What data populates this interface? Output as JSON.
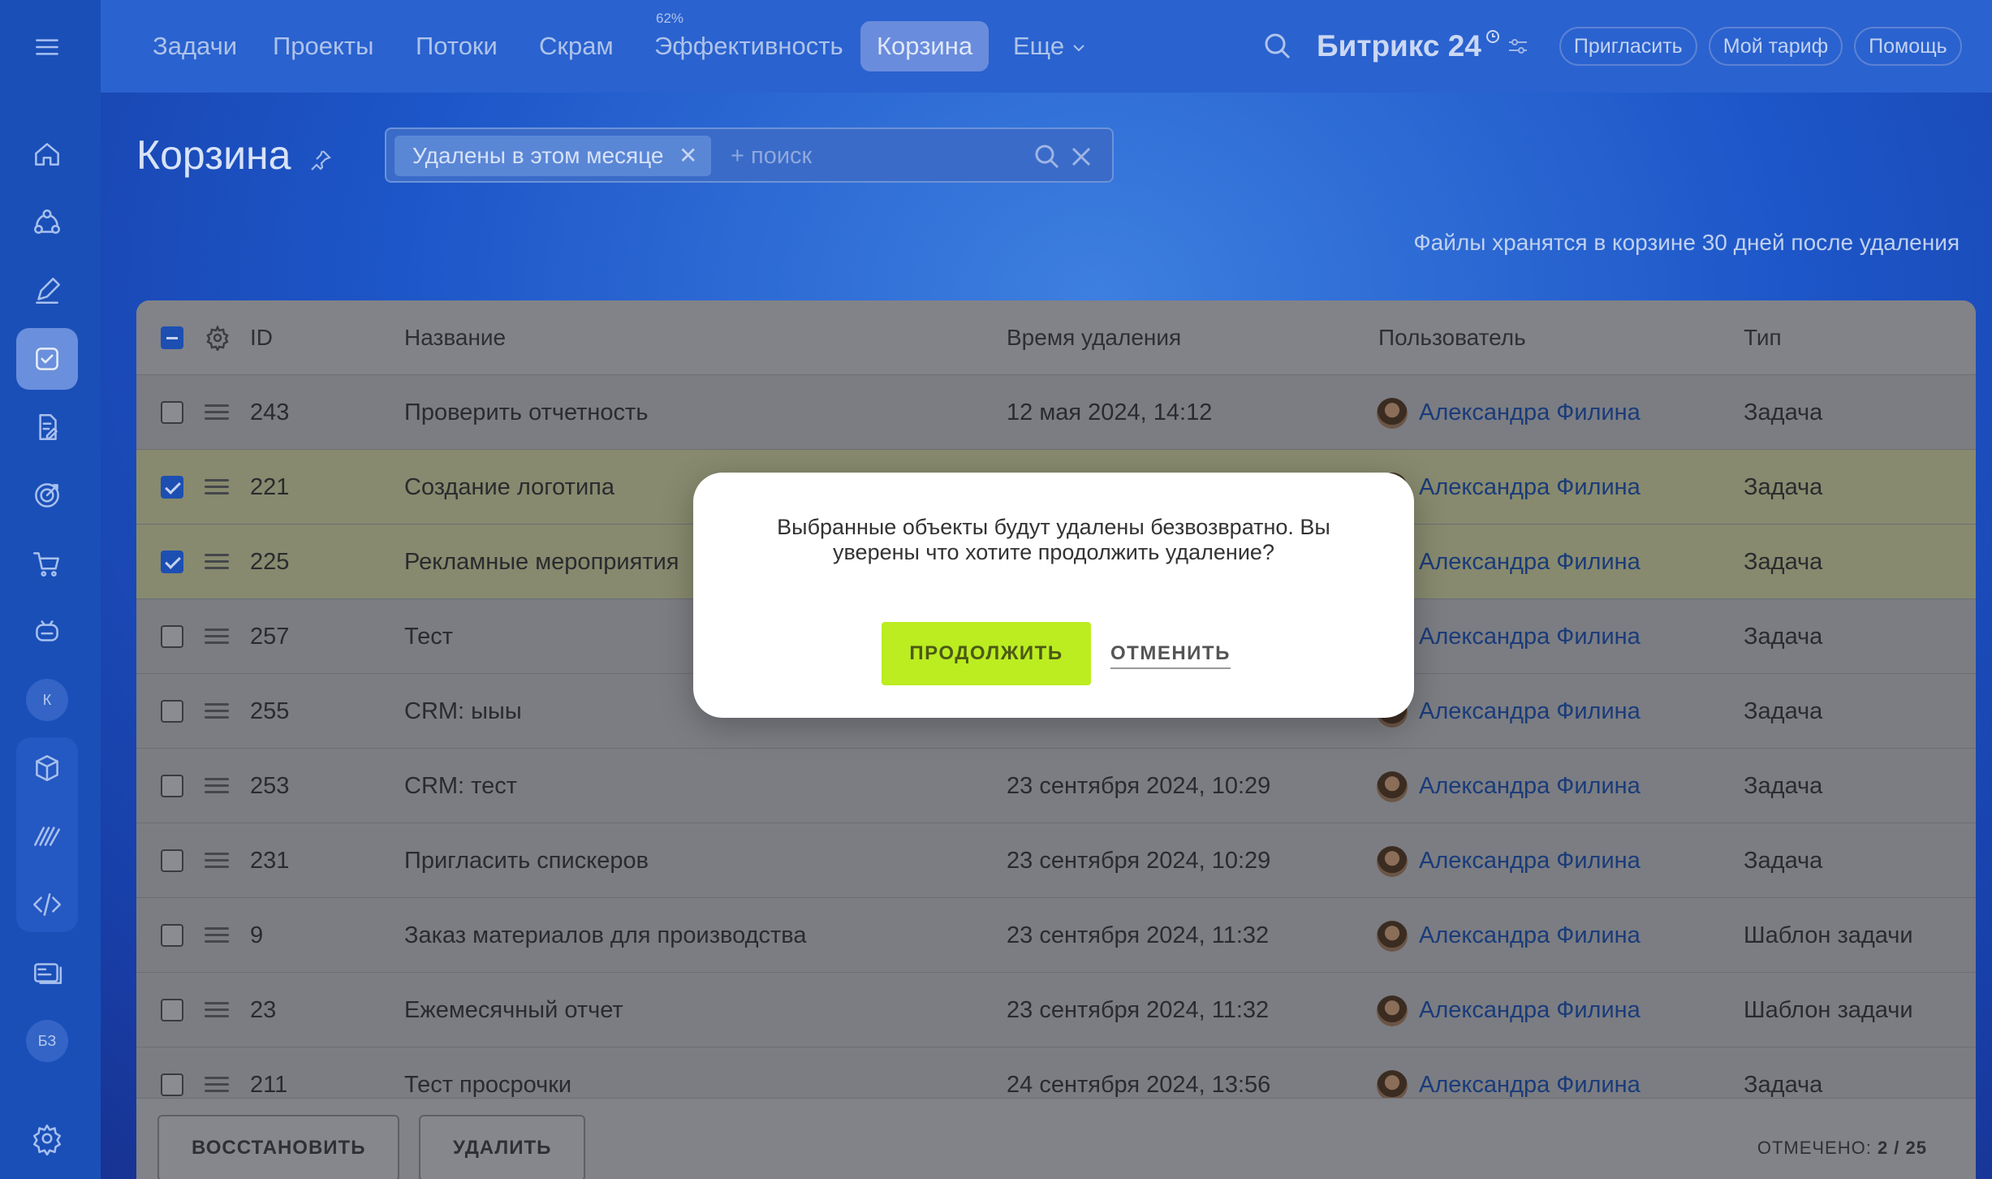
{
  "nav": {
    "items": [
      "Задачи",
      "Проекты",
      "Потоки",
      "Скрам",
      "Эффективность",
      "Корзина",
      "Еще"
    ],
    "efficiency_badge": "62%",
    "brand": "Битрикс 24",
    "invite": "Пригласить",
    "tariff": "Мой тариф",
    "help": "Помощь"
  },
  "sidebar": {
    "items": [
      "menu-icon",
      "home-icon",
      "crm-icon",
      "pen-icon",
      "tasks-icon",
      "docs-icon",
      "target-icon",
      "cart-icon",
      "robot-icon",
      "profile",
      "box-icon",
      "signature-icon",
      "code-icon",
      "cards-icon",
      "kb",
      "settings-icon"
    ],
    "profile_initial": "К",
    "kb_label": "БЗ"
  },
  "header": {
    "title": "Корзина",
    "filter_chip": "Удалены в этом месяце",
    "search_placeholder": "+ поиск",
    "storage_note": "Файлы хранятся в корзине 30 дней после удаления"
  },
  "grid": {
    "columns": [
      "ID",
      "Название",
      "Время удаления",
      "Пользователь",
      "Тип"
    ],
    "rows": [
      {
        "id": "243",
        "name": "Проверить отчетность",
        "time": "12 мая 2024, 14:12",
        "user": "Александра Филина",
        "type": "Задача",
        "checked": false
      },
      {
        "id": "221",
        "name": "Создание логотипа",
        "time": "",
        "user": "Александра Филина",
        "type": "Задача",
        "checked": true
      },
      {
        "id": "225",
        "name": "Рекламные мероприятия",
        "time": "",
        "user": "Александра Филина",
        "type": "Задача",
        "checked": true
      },
      {
        "id": "257",
        "name": "Тест",
        "time": "",
        "user": "Александра Филина",
        "type": "Задача",
        "checked": false
      },
      {
        "id": "255",
        "name": "CRM: ыыы",
        "time": "",
        "user": "Александра Филина",
        "type": "Задача",
        "checked": false
      },
      {
        "id": "253",
        "name": "CRM: тест",
        "time": "23 сентября 2024, 10:29",
        "user": "Александра Филина",
        "type": "Задача",
        "checked": false
      },
      {
        "id": "231",
        "name": "Пригласить спискеров",
        "time": "23 сентября 2024, 10:29",
        "user": "Александра Филина",
        "type": "Задача",
        "checked": false
      },
      {
        "id": "9",
        "name": "Заказ материалов для производства",
        "time": "23 сентября 2024, 11:32",
        "user": "Александра Филина",
        "type": "Шаблон задачи",
        "checked": false
      },
      {
        "id": "23",
        "name": "Ежемесячный отчет",
        "time": "23 сентября 2024, 11:32",
        "user": "Александра Филина",
        "type": "Шаблон задачи",
        "checked": false
      },
      {
        "id": "211",
        "name": "Тест просрочки",
        "time": "24 сентября 2024, 13:56",
        "user": "Александра Филина",
        "type": "Задача",
        "checked": false
      }
    ]
  },
  "footer": {
    "restore": "ВОССТАНОВИТЬ",
    "delete": "УДАЛИТЬ",
    "selected_label": "ОТМЕЧЕНО:",
    "selected_value": "2 / 25"
  },
  "modal": {
    "text": "Выбранные объекты будут удалены безвозвратно. Вы уверены что хотите продолжить удаление?",
    "continue": "ПРОДОЛЖИТЬ",
    "cancel": "ОТМЕНИТЬ"
  }
}
